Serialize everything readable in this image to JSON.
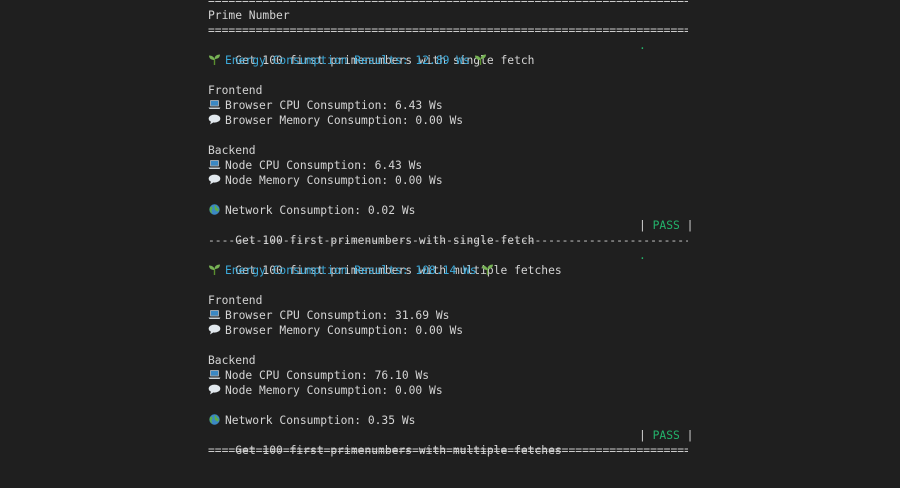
{
  "rules": {
    "double": "================================================================================",
    "single": "--------------------------------------------------------------------------------"
  },
  "header": {
    "title": "Prime Number"
  },
  "tests": [
    {
      "name": "Get 100 first primenumbers with single fetch",
      "running_marker": ".",
      "energy_label": "Energy Consumption Results: 12.89 Ws",
      "frontend_label": "Frontend",
      "browser_cpu": "Browser CPU Consumption: 6.43 Ws",
      "browser_memory": "Browser Memory Consumption: 0.00 Ws",
      "backend_label": "Backend",
      "node_cpu": "Node CPU Consumption: 6.43 Ws",
      "node_memory": "Node Memory Consumption: 0.00 Ws",
      "network": "Network Consumption: 0.02 Ws",
      "result_name": "Get 100 first primenumbers with single fetch",
      "pipe_left": "| ",
      "status": "PASS",
      "pipe_right": " |"
    },
    {
      "name": "Get 100 first primenumbers with multiple fetches",
      "running_marker": ".",
      "energy_label": "Energy Consumption Results: 108.14 Ws",
      "frontend_label": "Frontend",
      "browser_cpu": "Browser CPU Consumption: 31.69 Ws",
      "browser_memory": "Browser Memory Consumption: 0.00 Ws",
      "backend_label": "Backend",
      "node_cpu": "Node CPU Consumption: 76.10 Ws",
      "node_memory": "Node Memory Consumption: 0.00 Ws",
      "network": "Network Consumption: 0.35 Ws",
      "result_name": "Get 100 first primenumbers with multiple fetches",
      "pipe_left": "| ",
      "status": "PASS",
      "pipe_right": " |"
    }
  ],
  "icons": {
    "energy": "seedling-icon",
    "cpu": "laptop-icon",
    "memory": "speech-bubble-icon",
    "network": "globe-icon"
  },
  "colors": {
    "background": "#1f1f1f",
    "text": "#d4d4d4",
    "energy": "#3ba9d9",
    "pass": "#23b36b"
  }
}
